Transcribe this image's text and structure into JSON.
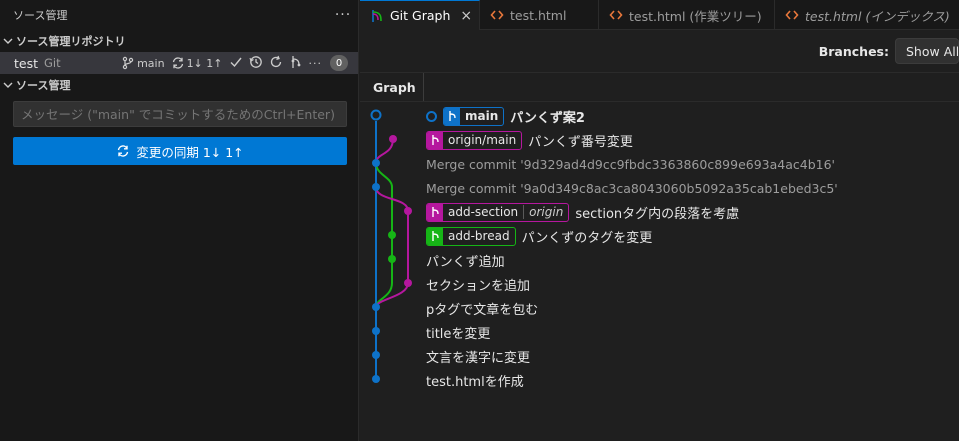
{
  "sidebar": {
    "title": "ソース管理",
    "more_icon": "ellipsis-icon",
    "repos_section": "ソース管理リポジトリ",
    "repo": {
      "name": "test",
      "kind": "Git",
      "branch": "main",
      "sync_counts": "1↓ 1↑",
      "badge": "0"
    },
    "changes_section": "ソース管理",
    "message_placeholder": "メッセージ (\"main\" でコミットするためのCtrl+Enter)",
    "sync_button": "変更の同期 1↓ 1↑"
  },
  "tabs": [
    {
      "label": "Git Graph",
      "close": "×"
    },
    {
      "label": "test.html"
    },
    {
      "label": "test.html (作業ツリー)"
    },
    {
      "label": "test.html (インデックス)"
    }
  ],
  "toolbar": {
    "branches_label": "Branches:",
    "branches_value": "Show All"
  },
  "graph_header": "Graph",
  "commits": [
    {
      "refs": [
        {
          "name": "main",
          "type": "main"
        }
      ],
      "message": "パンくず案2"
    },
    {
      "refs": [
        {
          "name": "origin/main",
          "type": "origin"
        }
      ],
      "message": "パンくず番号変更"
    },
    {
      "refs": [],
      "message": "Merge commit '9d329ad4d9cc9fbdc3363860c899e693a4ac4b16'"
    },
    {
      "refs": [],
      "message": "Merge commit '9a0d349c8ac3ca8043060b5092a35cab1ebed3c5'"
    },
    {
      "refs": [
        {
          "name": "add-section",
          "sub": "origin",
          "type": "section"
        }
      ],
      "message": "sectionタグ内の段落を考慮"
    },
    {
      "refs": [
        {
          "name": "add-bread",
          "type": "bread"
        }
      ],
      "message": "パンくずのタグを変更"
    },
    {
      "refs": [],
      "message": "パンくず追加"
    },
    {
      "refs": [],
      "message": "セクションを追加"
    },
    {
      "refs": [],
      "message": "pタグで文章を包む"
    },
    {
      "refs": [],
      "message": "titleを変更"
    },
    {
      "refs": [],
      "message": "文言を漢字に変更"
    },
    {
      "refs": [],
      "message": "test.htmlを作成"
    }
  ],
  "colors": {
    "blue": "#0e72c8",
    "magenta": "#b5179e",
    "green": "#16b516",
    "accent": "#0078d4"
  }
}
